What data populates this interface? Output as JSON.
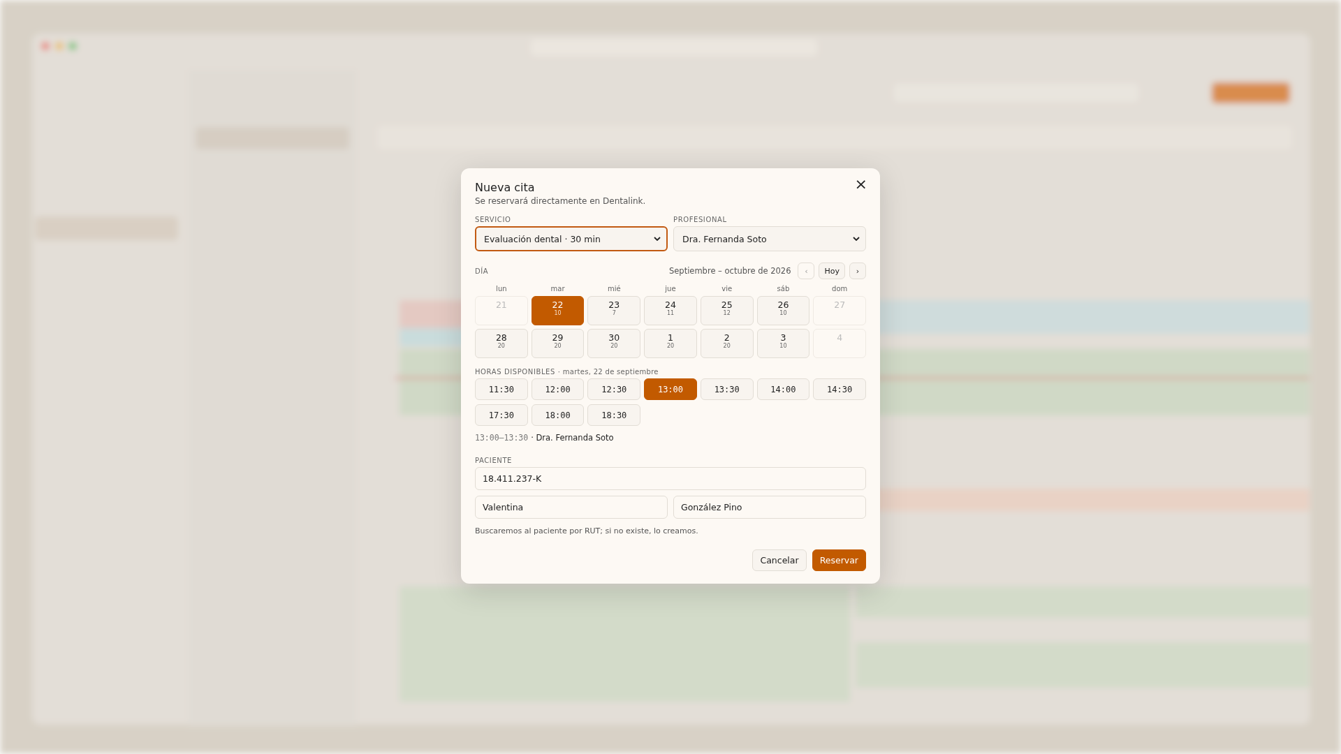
{
  "dialog": {
    "title": "Nueva cita",
    "subtitle": "Se reservará directamente en Dentalink.",
    "close": "×",
    "service": {
      "label": "SERVICIO",
      "value": "Evaluación dental · 30 min",
      "focused": true
    },
    "professional": {
      "label": "PROFESIONAL",
      "value": "Dra. Fernanda Soto",
      "focused": false
    },
    "calendar": {
      "label": "DÍA",
      "range": "Septiembre – octubre de 2026",
      "prev": "‹",
      "today": "Hoy",
      "next": "›",
      "weekdays": [
        "lun",
        "mar",
        "mié",
        "jue",
        "vie",
        "sáb",
        "dom"
      ],
      "days": [
        {
          "day": "21",
          "disabled": true,
          "selected": false
        },
        {
          "day": "22",
          "count": "10",
          "disabled": false,
          "selected": true
        },
        {
          "day": "23",
          "count": "7",
          "disabled": false,
          "selected": false
        },
        {
          "day": "24",
          "count": "11",
          "disabled": false,
          "selected": false
        },
        {
          "day": "25",
          "count": "12",
          "disabled": false,
          "selected": false
        },
        {
          "day": "26",
          "count": "10",
          "disabled": false,
          "selected": false
        },
        {
          "day": "27",
          "disabled": true,
          "selected": false
        },
        {
          "day": "28",
          "count": "20",
          "disabled": false,
          "selected": false
        },
        {
          "day": "29",
          "count": "20",
          "disabled": false,
          "selected": false
        },
        {
          "day": "30",
          "count": "20",
          "disabled": false,
          "selected": false
        },
        {
          "day": "1",
          "count": "20",
          "disabled": false,
          "selected": false
        },
        {
          "day": "2",
          "count": "20",
          "disabled": false,
          "selected": false
        },
        {
          "day": "3",
          "count": "10",
          "disabled": false,
          "selected": false
        },
        {
          "day": "4",
          "disabled": true,
          "selected": false
        }
      ]
    },
    "times": {
      "label": "HORAS DISPONIBLES",
      "date": "· martes, 22 de septiembre",
      "slots": [
        {
          "time": "11:30",
          "selected": false
        },
        {
          "time": "12:00",
          "selected": false
        },
        {
          "time": "12:30",
          "selected": false
        },
        {
          "time": "13:00",
          "selected": true
        },
        {
          "time": "13:30",
          "selected": false
        },
        {
          "time": "14:00",
          "selected": false
        },
        {
          "time": "14:30",
          "selected": false
        },
        {
          "time": "17:30",
          "selected": false
        },
        {
          "time": "18:00",
          "selected": false
        },
        {
          "time": "18:30",
          "selected": false
        }
      ]
    },
    "summary": {
      "range": "13:00–13:30",
      "professional": "· Dra. Fernanda Soto"
    },
    "patient": {
      "label": "PACIENTE",
      "rut": "18.411.237-K",
      "first_name": "Valentina",
      "last_name": "González Pino",
      "hint": "Buscaremos al paciente por RUT; si no existe, lo creamos."
    },
    "buttons": {
      "cancel": "Cancelar",
      "submit": "Reservar"
    }
  }
}
